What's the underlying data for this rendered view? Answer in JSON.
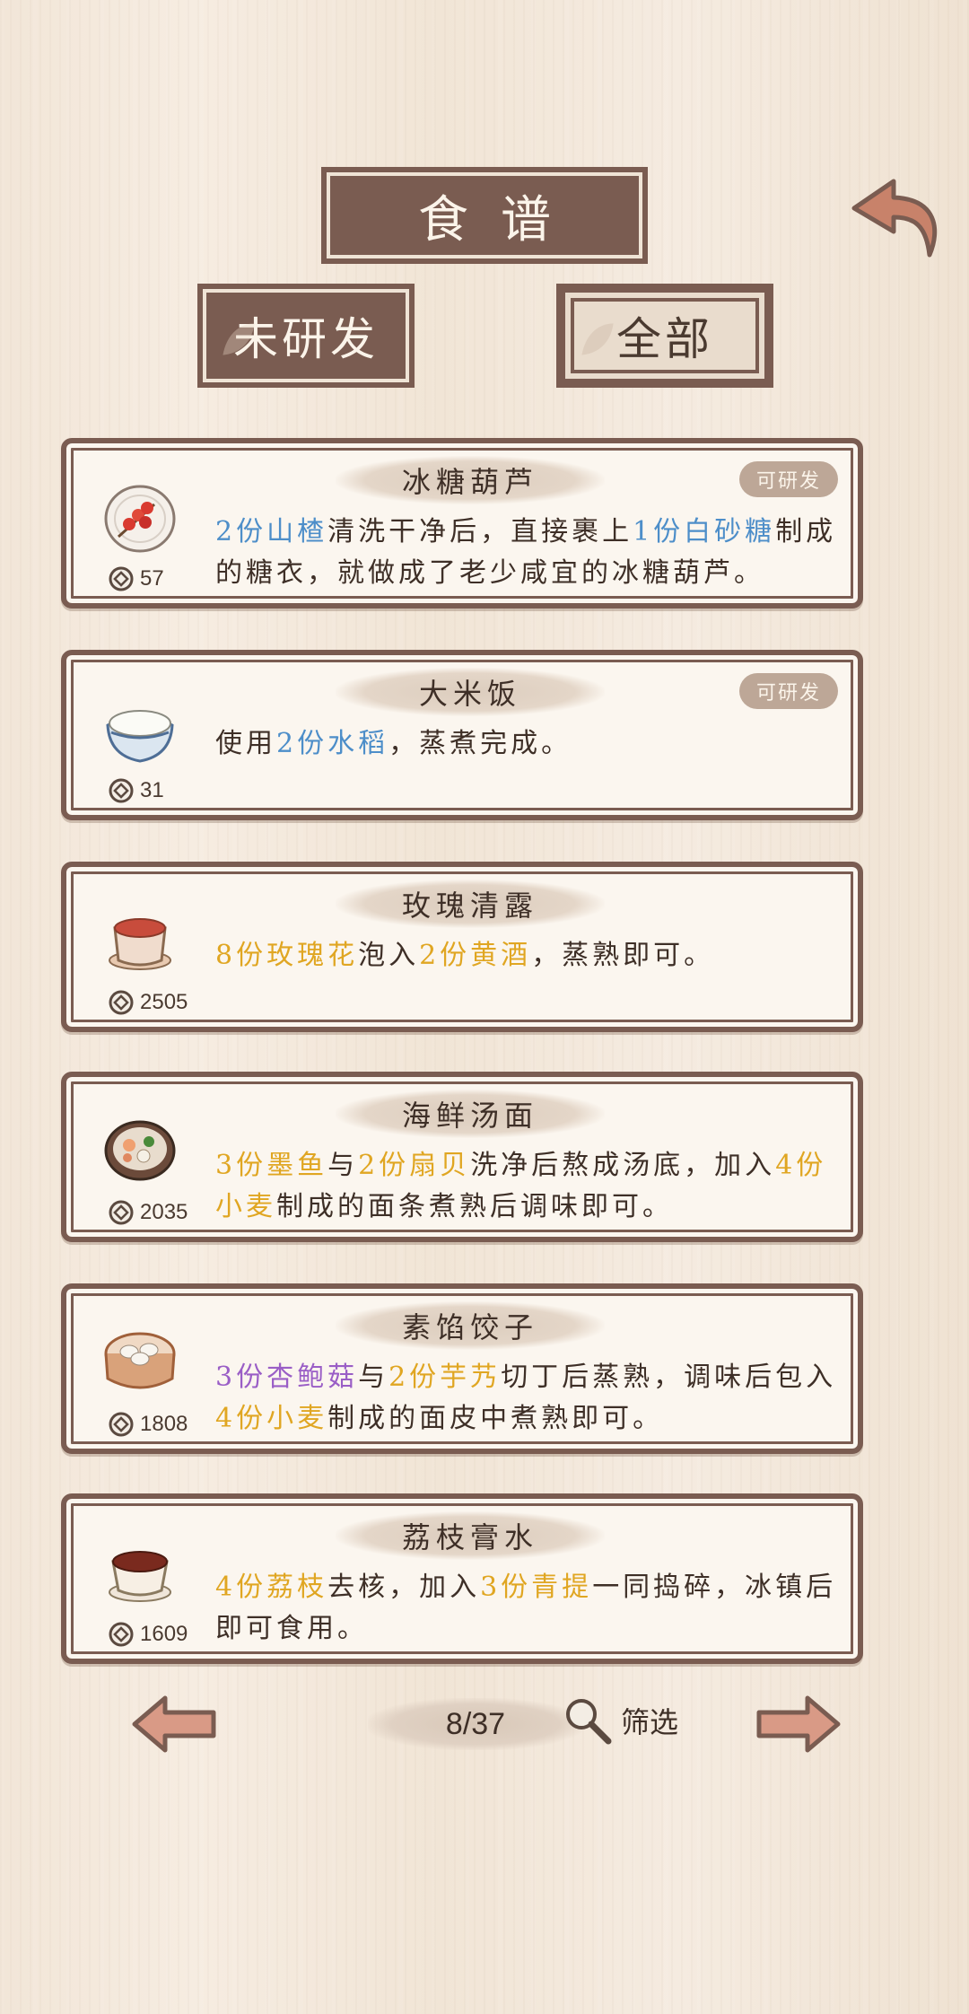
{
  "header": {
    "title": "食谱"
  },
  "tabs": [
    {
      "label": "未研发",
      "active": true
    },
    {
      "label": "全部",
      "active": false
    }
  ],
  "recipes": [
    {
      "name": "冰糖葫芦",
      "badge": "可研发",
      "cost": "57",
      "desc": [
        {
          "t": "2份山楂",
          "c": "blue"
        },
        {
          "t": "清洗干净后，直接裹上"
        },
        {
          "t": "1份白砂糖",
          "c": "blue"
        },
        {
          "t": "制成的糖衣，就做成了老少咸宜的冰糖葫芦。"
        }
      ],
      "dish_icon": "candied-haws-icon"
    },
    {
      "name": "大米饭",
      "badge": "可研发",
      "cost": "31",
      "desc": [
        {
          "t": "使用"
        },
        {
          "t": "2份水稻",
          "c": "blue"
        },
        {
          "t": "，蒸煮完成。"
        }
      ],
      "dish_icon": "rice-bowl-icon"
    },
    {
      "name": "玫瑰清露",
      "badge": "",
      "cost": "2505",
      "desc": [
        {
          "t": "8份玫瑰花",
          "c": "gold"
        },
        {
          "t": "泡入"
        },
        {
          "t": "2份黄酒",
          "c": "gold"
        },
        {
          "t": "，蒸熟即可。"
        }
      ],
      "dish_icon": "rose-drink-icon"
    },
    {
      "name": "海鲜汤面",
      "badge": "",
      "cost": "2035",
      "desc": [
        {
          "t": "3份墨鱼",
          "c": "gold"
        },
        {
          "t": "与"
        },
        {
          "t": "2份扇贝",
          "c": "gold"
        },
        {
          "t": "洗净后熬成汤底，加入"
        },
        {
          "t": "4份小麦",
          "c": "gold"
        },
        {
          "t": "制成的面条煮熟后调味即可。"
        }
      ],
      "dish_icon": "seafood-noodle-icon"
    },
    {
      "name": "素馅饺子",
      "badge": "",
      "cost": "1808",
      "desc": [
        {
          "t": "3份杏鲍菇",
          "c": "purple"
        },
        {
          "t": "与"
        },
        {
          "t": "2份芋艿",
          "c": "gold"
        },
        {
          "t": "切丁后蒸熟，调味后包入"
        },
        {
          "t": "4份小麦",
          "c": "gold"
        },
        {
          "t": "制成的面皮中煮熟即可。"
        }
      ],
      "dish_icon": "dumpling-steamer-icon"
    },
    {
      "name": "荔枝膏水",
      "badge": "",
      "cost": "1609",
      "desc": [
        {
          "t": "4份荔枝",
          "c": "gold"
        },
        {
          "t": "去核，加入"
        },
        {
          "t": "3份青提",
          "c": "gold"
        },
        {
          "t": "一同捣碎，冰镇后即可食用。"
        }
      ],
      "dish_icon": "lychee-drink-icon"
    }
  ],
  "pagination": {
    "page": "8/37",
    "filter_label": "筛选"
  },
  "colors": {
    "frame": "#7a5c51",
    "blue": "#4d8ec9",
    "gold": "#e0a622",
    "purple": "#9a5ec6"
  }
}
